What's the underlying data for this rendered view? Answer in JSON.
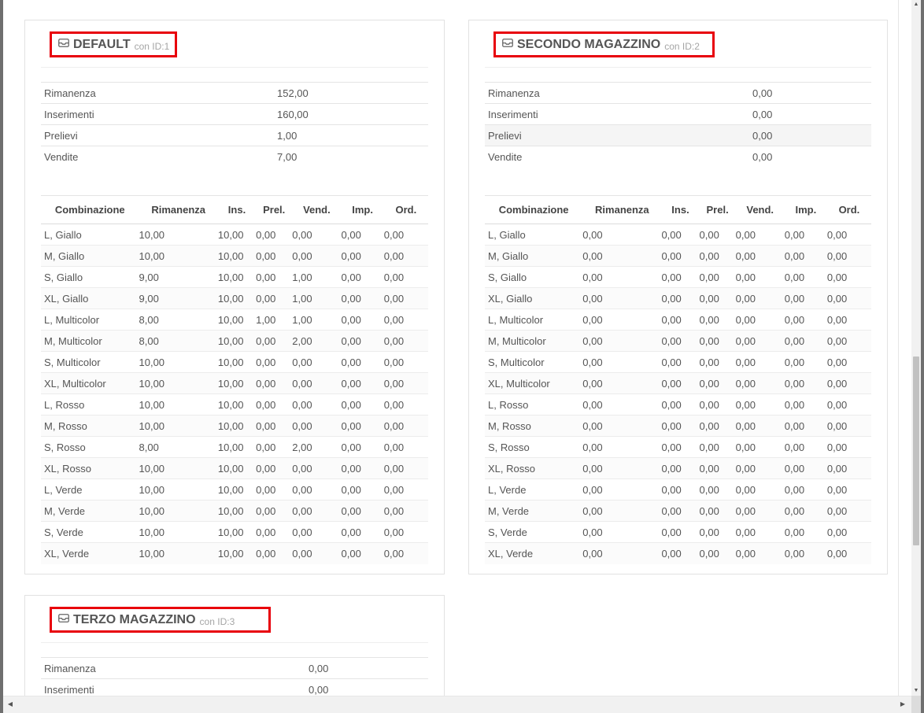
{
  "colors": {
    "highlight": "#e8000b",
    "border": "#e2e2e2",
    "text": "#555555",
    "muted": "#a5a5a5"
  },
  "icons": {
    "warehouse": "inbox-tray-icon"
  },
  "combo_columns": [
    "Combinazione",
    "Rimanenza",
    "Ins.",
    "Prel.",
    "Vend.",
    "Imp.",
    "Ord."
  ],
  "warehouses": [
    {
      "title": "DEFAULT",
      "id_label": "con ID:1",
      "summary": [
        {
          "label": "Rimanenza",
          "value": "152,00"
        },
        {
          "label": "Inserimenti",
          "value": "160,00"
        },
        {
          "label": "Prelievi",
          "value": "1,00"
        },
        {
          "label": "Vendite",
          "value": "7,00"
        }
      ],
      "combinations": [
        [
          "L, Giallo",
          "10,00",
          "10,00",
          "0,00",
          "0,00",
          "0,00",
          "0,00"
        ],
        [
          "M, Giallo",
          "10,00",
          "10,00",
          "0,00",
          "0,00",
          "0,00",
          "0,00"
        ],
        [
          "S, Giallo",
          "9,00",
          "10,00",
          "0,00",
          "1,00",
          "0,00",
          "0,00"
        ],
        [
          "XL, Giallo",
          "9,00",
          "10,00",
          "0,00",
          "1,00",
          "0,00",
          "0,00"
        ],
        [
          "L, Multicolor",
          "8,00",
          "10,00",
          "1,00",
          "1,00",
          "0,00",
          "0,00"
        ],
        [
          "M, Multicolor",
          "8,00",
          "10,00",
          "0,00",
          "2,00",
          "0,00",
          "0,00"
        ],
        [
          "S, Multicolor",
          "10,00",
          "10,00",
          "0,00",
          "0,00",
          "0,00",
          "0,00"
        ],
        [
          "XL, Multicolor",
          "10,00",
          "10,00",
          "0,00",
          "0,00",
          "0,00",
          "0,00"
        ],
        [
          "L, Rosso",
          "10,00",
          "10,00",
          "0,00",
          "0,00",
          "0,00",
          "0,00"
        ],
        [
          "M, Rosso",
          "10,00",
          "10,00",
          "0,00",
          "0,00",
          "0,00",
          "0,00"
        ],
        [
          "S, Rosso",
          "8,00",
          "10,00",
          "0,00",
          "2,00",
          "0,00",
          "0,00"
        ],
        [
          "XL, Rosso",
          "10,00",
          "10,00",
          "0,00",
          "0,00",
          "0,00",
          "0,00"
        ],
        [
          "L, Verde",
          "10,00",
          "10,00",
          "0,00",
          "0,00",
          "0,00",
          "0,00"
        ],
        [
          "M, Verde",
          "10,00",
          "10,00",
          "0,00",
          "0,00",
          "0,00",
          "0,00"
        ],
        [
          "S, Verde",
          "10,00",
          "10,00",
          "0,00",
          "0,00",
          "0,00",
          "0,00"
        ],
        [
          "XL, Verde",
          "10,00",
          "10,00",
          "0,00",
          "0,00",
          "0,00",
          "0,00"
        ]
      ]
    },
    {
      "title": "SECONDO MAGAZZINO",
      "id_label": "con ID:2",
      "summary": [
        {
          "label": "Rimanenza",
          "value": "0,00"
        },
        {
          "label": "Inserimenti",
          "value": "0,00"
        },
        {
          "label": "Prelievi",
          "value": "0,00"
        },
        {
          "label": "Vendite",
          "value": "0,00"
        }
      ],
      "combinations": [
        [
          "L, Giallo",
          "0,00",
          "0,00",
          "0,00",
          "0,00",
          "0,00",
          "0,00"
        ],
        [
          "M, Giallo",
          "0,00",
          "0,00",
          "0,00",
          "0,00",
          "0,00",
          "0,00"
        ],
        [
          "S, Giallo",
          "0,00",
          "0,00",
          "0,00",
          "0,00",
          "0,00",
          "0,00"
        ],
        [
          "XL, Giallo",
          "0,00",
          "0,00",
          "0,00",
          "0,00",
          "0,00",
          "0,00"
        ],
        [
          "L, Multicolor",
          "0,00",
          "0,00",
          "0,00",
          "0,00",
          "0,00",
          "0,00"
        ],
        [
          "M, Multicolor",
          "0,00",
          "0,00",
          "0,00",
          "0,00",
          "0,00",
          "0,00"
        ],
        [
          "S, Multicolor",
          "0,00",
          "0,00",
          "0,00",
          "0,00",
          "0,00",
          "0,00"
        ],
        [
          "XL, Multicolor",
          "0,00",
          "0,00",
          "0,00",
          "0,00",
          "0,00",
          "0,00"
        ],
        [
          "L, Rosso",
          "0,00",
          "0,00",
          "0,00",
          "0,00",
          "0,00",
          "0,00"
        ],
        [
          "M, Rosso",
          "0,00",
          "0,00",
          "0,00",
          "0,00",
          "0,00",
          "0,00"
        ],
        [
          "S, Rosso",
          "0,00",
          "0,00",
          "0,00",
          "0,00",
          "0,00",
          "0,00"
        ],
        [
          "XL, Rosso",
          "0,00",
          "0,00",
          "0,00",
          "0,00",
          "0,00",
          "0,00"
        ],
        [
          "L, Verde",
          "0,00",
          "0,00",
          "0,00",
          "0,00",
          "0,00",
          "0,00"
        ],
        [
          "M, Verde",
          "0,00",
          "0,00",
          "0,00",
          "0,00",
          "0,00",
          "0,00"
        ],
        [
          "S, Verde",
          "0,00",
          "0,00",
          "0,00",
          "0,00",
          "0,00",
          "0,00"
        ],
        [
          "XL, Verde",
          "0,00",
          "0,00",
          "0,00",
          "0,00",
          "0,00",
          "0,00"
        ]
      ]
    },
    {
      "title": "TERZO MAGAZZINO",
      "id_label": "con ID:3",
      "summary": [
        {
          "label": "Rimanenza",
          "value": "0,00"
        },
        {
          "label": "Inserimenti",
          "value": "0,00"
        }
      ],
      "combinations": []
    }
  ]
}
